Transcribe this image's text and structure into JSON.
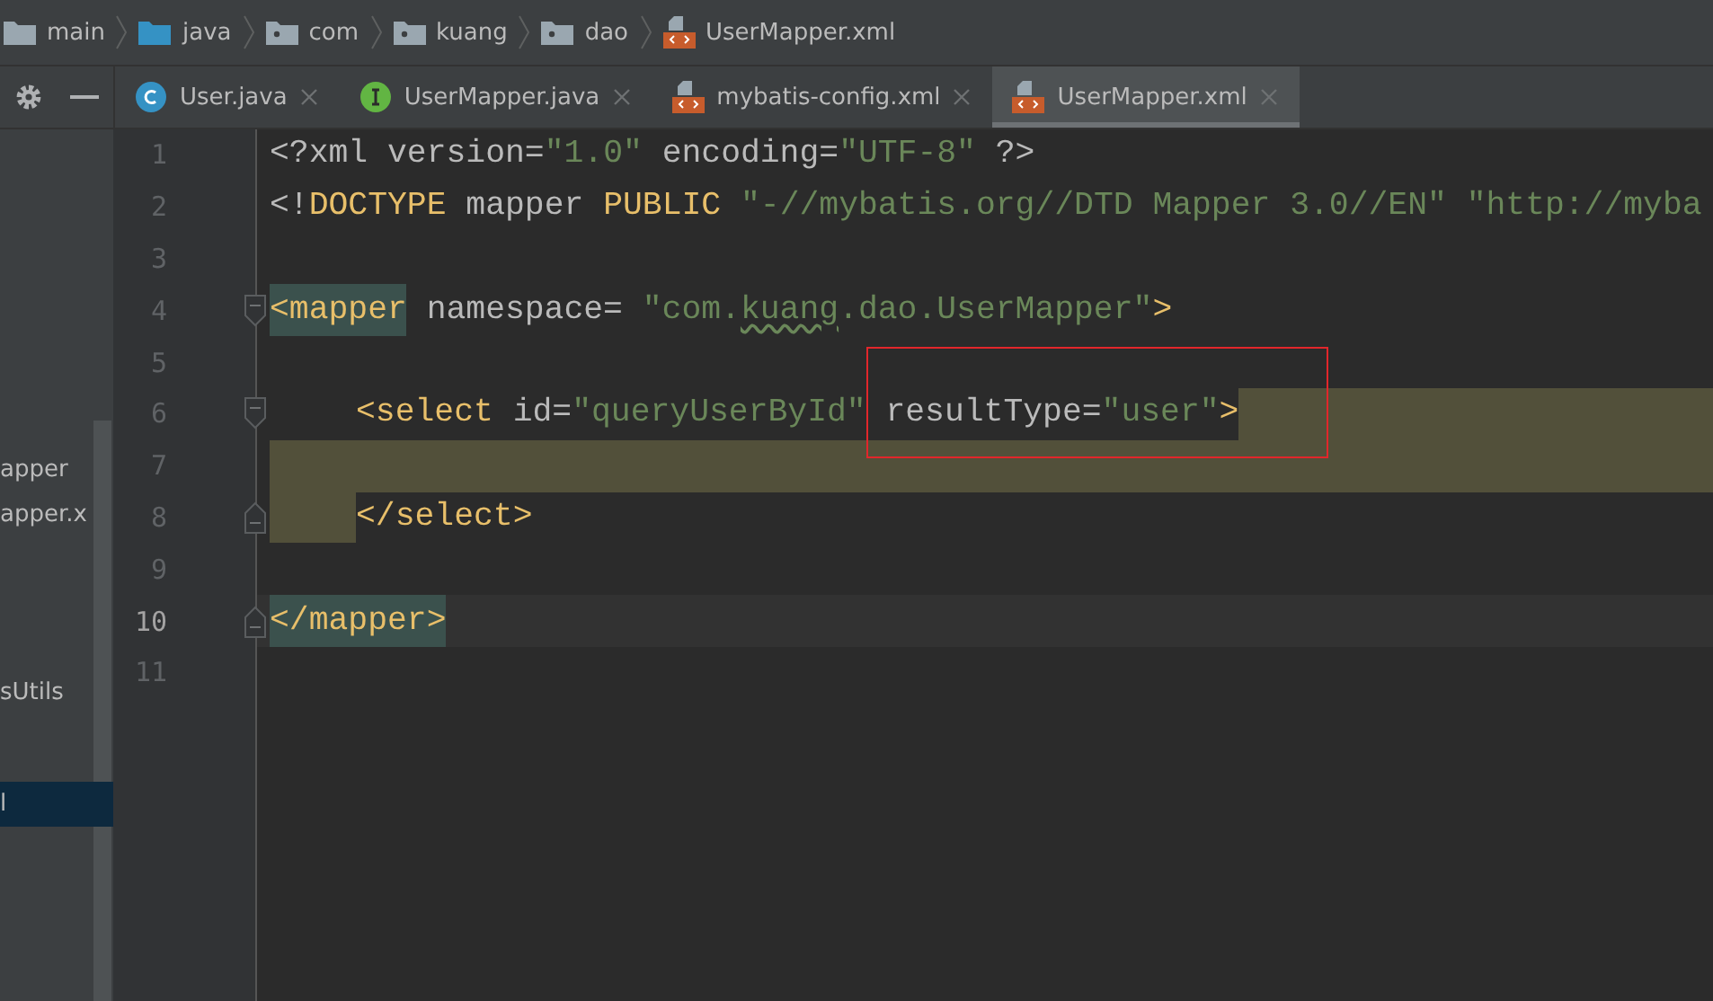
{
  "breadcrumbs": [
    {
      "label": "main",
      "kind": "folder"
    },
    {
      "label": "java",
      "kind": "source"
    },
    {
      "label": "com",
      "kind": "package"
    },
    {
      "label": "kuang",
      "kind": "package"
    },
    {
      "label": "dao",
      "kind": "package"
    },
    {
      "label": "UserMapper.xml",
      "kind": "xml"
    }
  ],
  "tabs": [
    {
      "label": "User.java",
      "kind": "class",
      "selected": false
    },
    {
      "label": "UserMapper.java",
      "kind": "interface",
      "selected": false
    },
    {
      "label": "mybatis-config.xml",
      "kind": "xml",
      "selected": false
    },
    {
      "label": "UserMapper.xml",
      "kind": "xml",
      "selected": true
    }
  ],
  "project_tree": {
    "items": [
      {
        "label": "apper",
        "selected": false
      },
      {
        "label": "apper.x",
        "selected": false
      },
      {
        "label": "sUtils",
        "selected": false
      },
      {
        "label": "l",
        "selected": true
      }
    ]
  },
  "editor": {
    "lines": [
      {
        "number": "1",
        "current": false,
        "fold_start": false,
        "fold_end": false,
        "selected": false,
        "indented": false,
        "tokens": [
          {
            "kind": "plain",
            "text": "<?xml "
          },
          {
            "kind": "name",
            "text": "version="
          },
          {
            "kind": "string",
            "text": "\"1.0\""
          },
          {
            "kind": "name",
            "text": " encoding="
          },
          {
            "kind": "string",
            "text": "\"UTF-8\""
          },
          {
            "kind": "plain",
            "text": " ?>"
          }
        ]
      },
      {
        "number": "2",
        "current": false,
        "fold_start": false,
        "fold_end": false,
        "selected": false,
        "indented": false,
        "tokens": [
          {
            "kind": "plain",
            "text": "<!"
          },
          {
            "kind": "tag",
            "text": "DOCTYPE"
          },
          {
            "kind": "name",
            "text": " mapper "
          },
          {
            "kind": "tag",
            "text": "PUBLIC"
          },
          {
            "kind": "string",
            "text": " \"-//mybatis.org//DTD Mapper 3.0//EN\" \"http://myba"
          }
        ]
      },
      {
        "number": "3",
        "current": false,
        "fold_start": false,
        "fold_end": false,
        "selected": false
      },
      {
        "number": "4",
        "current": false,
        "fold_start": true,
        "fold_end": false,
        "selected": false,
        "indented": false,
        "tokens": [
          {
            "kind": "tag",
            "text": "<mapper",
            "match": true
          },
          {
            "kind": "name",
            "text": " namespace= "
          },
          {
            "kind": "string",
            "text": "\"com."
          },
          {
            "kind": "string",
            "text": "kuang",
            "typo": true
          },
          {
            "kind": "string",
            "text": ".dao.UserMapper\""
          },
          {
            "kind": "tag",
            "text": ">"
          }
        ]
      },
      {
        "number": "5",
        "current": false,
        "fold_start": false,
        "fold_end": false,
        "selected": false
      },
      {
        "number": "6",
        "current": false,
        "fold_start": true,
        "fold_end": false,
        "selected": true,
        "indented": true,
        "tokens": [
          {
            "kind": "tag",
            "text": "<select"
          },
          {
            "kind": "name",
            "text": " id="
          },
          {
            "kind": "string",
            "text": "\"queryUserById\""
          },
          {
            "kind": "name",
            "text": " resultType="
          },
          {
            "kind": "string",
            "text": "\"user\""
          },
          {
            "kind": "tag",
            "text": ">"
          }
        ]
      },
      {
        "number": "7",
        "current": false,
        "fold_start": false,
        "fold_end": false,
        "selected": true
      },
      {
        "number": "8",
        "current": false,
        "fold_start": false,
        "fold_end": true,
        "selected": true,
        "indented": true,
        "tokens": [
          {
            "kind": "tag",
            "text": "</select>"
          }
        ]
      },
      {
        "number": "9",
        "current": false,
        "fold_start": false,
        "fold_end": false,
        "selected": false
      },
      {
        "number": "10",
        "current": true,
        "fold_start": false,
        "fold_end": true,
        "selected": false,
        "indented": false,
        "tokens": [
          {
            "kind": "tag",
            "text": "</mapper>",
            "match": true
          }
        ]
      },
      {
        "number": "11",
        "current": false,
        "fold_start": false,
        "fold_end": false,
        "selected": false
      }
    ]
  }
}
